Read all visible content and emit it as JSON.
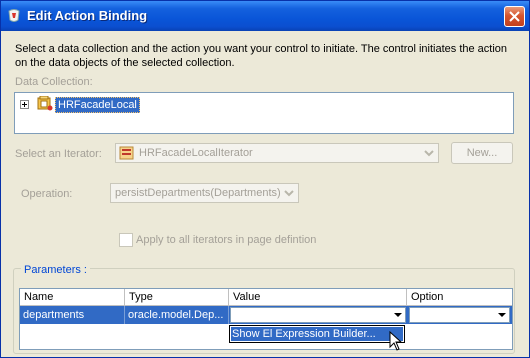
{
  "window": {
    "title": "Edit Action Binding",
    "icons": {
      "app": "jdeveloper-icon",
      "close": "close-icon"
    }
  },
  "description": "Select a data collection and the action you want your control to initiate. The control initiates the action on the data objects of the selected collection.",
  "data_collection": {
    "label": "Data Collection:",
    "tree_item": "HRFacadeLocal"
  },
  "iterator": {
    "label": "Select an Iterator:",
    "value": "HRFacadeLocalIterator",
    "new_button": "New..."
  },
  "operation": {
    "label": "Operation:",
    "value": "persistDepartments(Departments)"
  },
  "apply_all": {
    "label": "Apply to all iterators in page defintion",
    "checked": false
  },
  "parameters": {
    "legend": "Parameters :",
    "columns": [
      "Name",
      "Type",
      "Value",
      "Option"
    ],
    "rows": [
      {
        "name": "departments",
        "type": "oracle.model.Dep...",
        "value": "",
        "option": ""
      }
    ],
    "value_dropdown": [
      "Show El Expression Builder..."
    ]
  },
  "colors": {
    "title_bar": "#0a55d8",
    "selection": "#316ac5",
    "dialog_bg": "#ece9d8",
    "legend_text": "#0046d5"
  }
}
